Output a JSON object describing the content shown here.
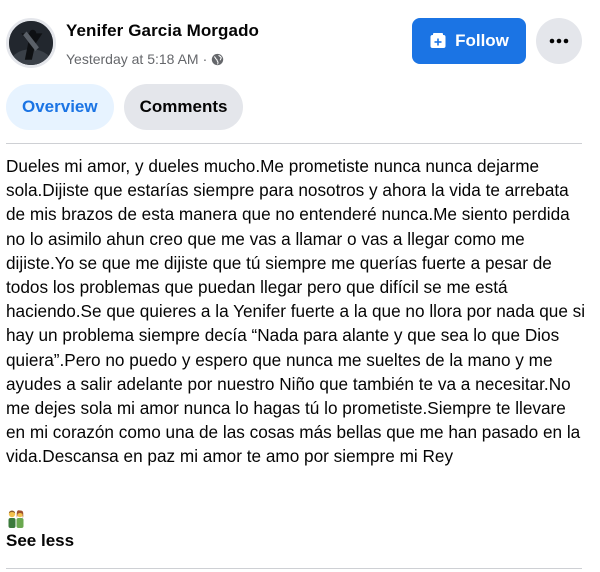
{
  "header": {
    "author": "Yenifer Garcia Morgado",
    "timestamp": "Yesterday at 5:18 AM",
    "separator": "·",
    "privacy_icon": "globe-icon",
    "avatar_icon": "profile-photo"
  },
  "actions": {
    "follow_label": "Follow",
    "follow_icon": "add-page-icon",
    "more_icon": "ellipsis-icon"
  },
  "tabs": [
    {
      "label": "Overview",
      "active": true
    },
    {
      "label": "Comments",
      "active": false
    }
  ],
  "post": {
    "text": "Dueles mi amor, y dueles mucho.Me prometiste nunca nunca dejarme sola.Dijiste que estarías siempre para nosotros y ahora la vida te arrebata de mis brazos de esta manera que no entenderé nunca.Me siento perdida no lo asimilo ahun creo que me vas a llamar o vas a llegar como me dijiste.Yo se que me dijiste que tú siempre me querías fuerte a pesar de todos los problemas que puedan llegar pero que difícil se me está haciendo.Se que quieres a la Yenifer fuerte a la que no llora por nada que si hay un problema siempre decía “Nada para alante y que sea lo que Dios quiera”.Pero no puedo y espero que nunca me sueltes de la mano y me ayudes a salir adelante por nuestro Niño que también te va a necesitar.No me dejes sola mi amor nunca lo hagas tú lo prometiste.Siempre te llevare en mi corazón como una de las cosas más bellas que me han pasado en la vida.Descansa en paz mi amor te amo por siempre mi Rey",
    "emoji_icon": "couple-emoji",
    "see_less_label": "See less"
  },
  "colors": {
    "accent": "#1b74e4",
    "accent_light": "#e7f3ff",
    "secondary_bg": "#e4e6eb",
    "muted_text": "#65676b",
    "divider": "#ced0d4"
  }
}
